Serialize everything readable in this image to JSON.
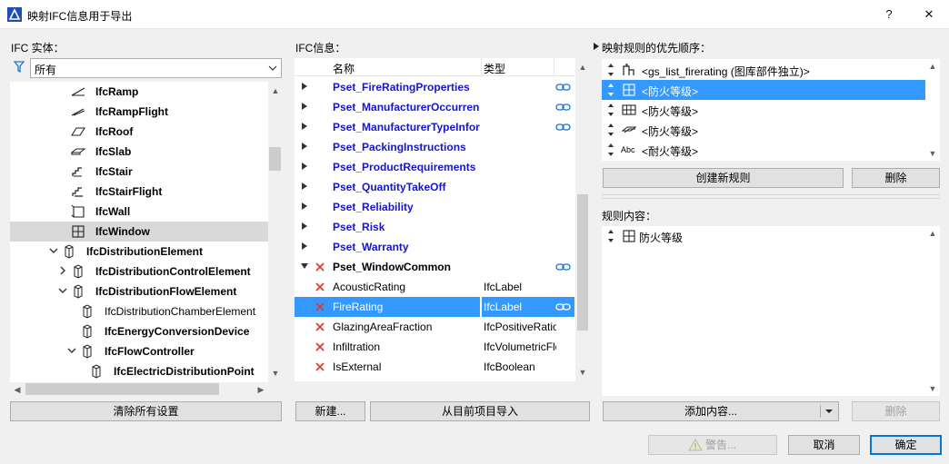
{
  "window": {
    "title": "映射IFC信息用于导出",
    "help_label": "?",
    "close_label": "✕"
  },
  "left": {
    "label": "IFC 实体：",
    "filter_value": "所有",
    "clear_button": "清除所有设置",
    "tree": [
      {
        "label": "IfcRamp",
        "icon": "ramp-icon",
        "level": 3,
        "expander": "none",
        "bold": true,
        "selected": false
      },
      {
        "label": "IfcRampFlight",
        "icon": "ramp-flight-icon",
        "level": 3,
        "expander": "none",
        "bold": true,
        "selected": false
      },
      {
        "label": "IfcRoof",
        "icon": "roof-icon",
        "level": 3,
        "expander": "none",
        "bold": true,
        "selected": false
      },
      {
        "label": "IfcSlab",
        "icon": "slab-icon",
        "level": 3,
        "expander": "none",
        "bold": true,
        "selected": false
      },
      {
        "label": "IfcStair",
        "icon": "stair-icon",
        "level": 3,
        "expander": "none",
        "bold": true,
        "selected": false
      },
      {
        "label": "IfcStairFlight",
        "icon": "stair-flight-icon",
        "level": 3,
        "expander": "none",
        "bold": true,
        "selected": false
      },
      {
        "label": "IfcWall",
        "icon": "wall-icon",
        "level": 3,
        "expander": "none",
        "bold": true,
        "selected": false
      },
      {
        "label": "IfcWindow",
        "icon": "window-icon",
        "level": 3,
        "expander": "none",
        "bold": true,
        "selected": true
      },
      {
        "label": "IfcDistributionElement",
        "icon": "element-icon",
        "level": 2,
        "expander": "open",
        "bold": true,
        "selected": false
      },
      {
        "label": "IfcDistributionControlElement",
        "icon": "element-icon",
        "level": 3,
        "expander": "closed",
        "bold": true,
        "selected": false
      },
      {
        "label": "IfcDistributionFlowElement",
        "icon": "element-icon",
        "level": 3,
        "expander": "open",
        "bold": true,
        "selected": false
      },
      {
        "label": "IfcDistributionChamberElement",
        "icon": "element-icon",
        "level": 4,
        "expander": "none",
        "bold": false,
        "selected": false
      },
      {
        "label": "IfcEnergyConversionDevice",
        "icon": "element-icon",
        "level": 4,
        "expander": "none",
        "bold": true,
        "selected": false
      },
      {
        "label": "IfcFlowController",
        "icon": "element-icon",
        "level": 4,
        "expander": "open",
        "bold": true,
        "selected": false
      },
      {
        "label": "IfcElectricDistributionPoint",
        "icon": "element-icon",
        "level": 5,
        "expander": "none",
        "bold": true,
        "selected": false
      }
    ]
  },
  "middle": {
    "label": "IFC信息：",
    "columns": {
      "name": "名称",
      "type": "类型"
    },
    "new_button": "新建...",
    "import_button": "从目前项目导入",
    "rows": [
      {
        "name": "Pset_FireRatingProperties",
        "type": "",
        "style": "blue",
        "expander": "closed",
        "x": false,
        "link": true,
        "selected": false
      },
      {
        "name": "Pset_ManufacturerOccurrence",
        "type": "",
        "style": "blue",
        "expander": "closed",
        "x": false,
        "link": true,
        "selected": false
      },
      {
        "name": "Pset_ManufacturerTypeInformation",
        "type": "",
        "style": "blue",
        "expander": "closed",
        "x": false,
        "link": true,
        "selected": false
      },
      {
        "name": "Pset_PackingInstructions",
        "type": "",
        "style": "blue",
        "expander": "closed",
        "x": false,
        "link": false,
        "selected": false
      },
      {
        "name": "Pset_ProductRequirements",
        "type": "",
        "style": "blue",
        "expander": "closed",
        "x": false,
        "link": false,
        "selected": false
      },
      {
        "name": "Pset_QuantityTakeOff",
        "type": "",
        "style": "blue",
        "expander": "closed",
        "x": false,
        "link": false,
        "selected": false
      },
      {
        "name": "Pset_Reliability",
        "type": "",
        "style": "blue",
        "expander": "closed",
        "x": false,
        "link": false,
        "selected": false
      },
      {
        "name": "Pset_Risk",
        "type": "",
        "style": "blue",
        "expander": "closed",
        "x": false,
        "link": false,
        "selected": false
      },
      {
        "name": "Pset_Warranty",
        "type": "",
        "style": "blue",
        "expander": "closed",
        "x": false,
        "link": false,
        "selected": false
      },
      {
        "name": "Pset_WindowCommon",
        "type": "",
        "style": "black",
        "expander": "open",
        "x": true,
        "link": true,
        "selected": false
      },
      {
        "name": "AcousticRating",
        "type": "IfcLabel",
        "style": "normal",
        "expander": "none",
        "x": true,
        "link": false,
        "selected": false
      },
      {
        "name": "FireRating",
        "type": "IfcLabel",
        "style": "normal",
        "expander": "none",
        "x": true,
        "link": true,
        "selected": true
      },
      {
        "name": "GlazingAreaFraction",
        "type": "IfcPositiveRatioMeasure",
        "style": "normal",
        "expander": "none",
        "x": true,
        "link": false,
        "selected": false
      },
      {
        "name": "Infiltration",
        "type": "IfcVolumetricFlowRateMeasure",
        "style": "normal",
        "expander": "none",
        "x": true,
        "link": false,
        "selected": false
      },
      {
        "name": "IsExternal",
        "type": "IfcBoolean",
        "style": "normal",
        "expander": "none",
        "x": true,
        "link": false,
        "selected": false
      }
    ]
  },
  "right": {
    "priority_label": "映射规则的优先顺序：",
    "rules": [
      {
        "label": "<gs_list_firerating (图库部件独立)>",
        "icon": "library-part-icon",
        "selected": false
      },
      {
        "label": "<防火等级>",
        "icon": "window-icon",
        "selected": true
      },
      {
        "label": "<防火等级>",
        "icon": "curtain-wall-icon",
        "selected": false
      },
      {
        "label": "<防火等级>",
        "icon": "door-panel-icon",
        "selected": false
      },
      {
        "label": "<耐火等级>",
        "icon": "text-abc-icon",
        "icon_text": "Abc",
        "selected": false
      }
    ],
    "create_rule_button": "创建新规则",
    "delete_rule_button": "删除",
    "content_label": "规则内容：",
    "content_items": [
      {
        "label": "防火等级",
        "icon": "window-icon"
      }
    ],
    "add_content_button": "添加内容...",
    "delete_content_button": "删除"
  },
  "footer": {
    "warning_button": "警告...",
    "cancel_button": "取消",
    "ok_button": "确定"
  }
}
